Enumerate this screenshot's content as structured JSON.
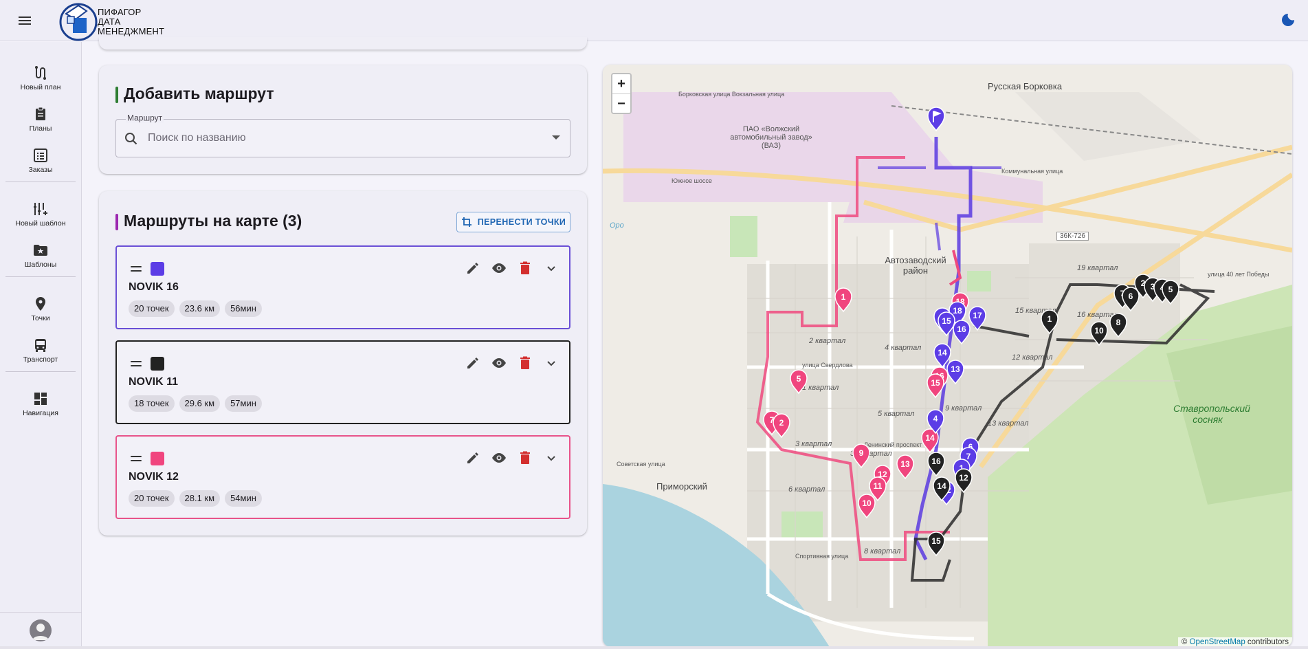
{
  "brand": {
    "line1": "ПИФАГОР",
    "line2": "ДАТА",
    "line3": "МЕНЕДЖМЕНТ"
  },
  "nav": {
    "groups": [
      [
        {
          "label": "Новый план",
          "icon": "route-icon"
        },
        {
          "label": "Планы",
          "icon": "clipboard-icon"
        },
        {
          "label": "Заказы",
          "icon": "list-icon"
        }
      ],
      [
        {
          "label": "Новый шаблон",
          "icon": "tune-add-icon"
        },
        {
          "label": "Шаблоны",
          "icon": "folder-star-icon"
        }
      ],
      [
        {
          "label": "Точки",
          "icon": "location-pin-icon"
        },
        {
          "label": "Транспорт",
          "icon": "bus-icon"
        }
      ],
      [
        {
          "label": "Навигация",
          "icon": "dashboard-icon"
        }
      ]
    ]
  },
  "add_route": {
    "title": "Добавить маршрут",
    "accent": "#2e7d32",
    "field_label": "Маршрут",
    "placeholder": "Поиск по названию"
  },
  "routes_panel": {
    "title": "Маршруты на карте (3)",
    "accent": "#9c27b0",
    "move_points_label": "ПЕРЕНЕСТИ ТОЧКИ",
    "routes": [
      {
        "name": "NOVIK 16",
        "color": "#5c3de6",
        "border": "#6a4fd6",
        "points": "20 точек",
        "distance": "23.6 км",
        "duration": "56мин"
      },
      {
        "name": "NOVIK 11",
        "color": "#222222",
        "border": "#222222",
        "points": "18 точек",
        "distance": "29.6 км",
        "duration": "57мин"
      },
      {
        "name": "NOVIK 12",
        "color": "#f0457e",
        "border": "#e8538a",
        "points": "20 точек",
        "distance": "28.1 км",
        "duration": "54мин"
      }
    ]
  },
  "map": {
    "zoom_in": "+",
    "zoom_out": "−",
    "attribution_prefix": "© ",
    "attribution_link": "OpenStreetMap",
    "attribution_suffix": " contributors",
    "labels": {
      "russkaya_borkovka": "Русская Борковка",
      "vaz": "ПАО «Волжский автомобильный завод» (ВАЗ)",
      "avtozavodsky": "Автозаводский район",
      "stavropolsky": "Ставропольский сосняк",
      "primorsky": "Приморский",
      "road_36k": "36К-726",
      "oro": "Оро",
      "yuzhnoe_shosse": "Южное шоссе",
      "kommunalnaya": "Коммунальная улица",
      "sverdlova": "улица Свердлова",
      "leninsky": "Ленинский проспект",
      "sportivnaya": "Спортивная улица",
      "sovetskaya": "Советская улица",
      "borkovskaya": "Борковская улица Вокзальная улица",
      "pobedy": "улица 40 лет Победы",
      "q19": "19 квартал",
      "q16": "16 квартал",
      "q15": "15 квартал",
      "q12": "12 квартал",
      "q13": "13 квартал",
      "q9": "9 квартал",
      "q5": "5 квартал",
      "q4": "4 квартал",
      "q3": "3 квартал",
      "q2": "2 квартал",
      "q1": "1 квартал",
      "q6": "6 квартал",
      "q8": "8 квартал",
      "q3a": "3А квартал"
    },
    "markers": {
      "purple": [
        "18",
        "17",
        "3",
        "15",
        "16",
        "14",
        "13",
        "4",
        "6",
        "7",
        "12",
        "1"
      ],
      "pink": [
        "18",
        "17",
        "1",
        "5",
        "7",
        "2",
        "9",
        "13",
        "12",
        "11",
        "10",
        "16",
        "15",
        "14"
      ],
      "black": [
        "2",
        "3",
        "4",
        "5",
        "7",
        "6",
        "1",
        "8",
        "10",
        "16",
        "12",
        "14",
        "15"
      ]
    }
  }
}
